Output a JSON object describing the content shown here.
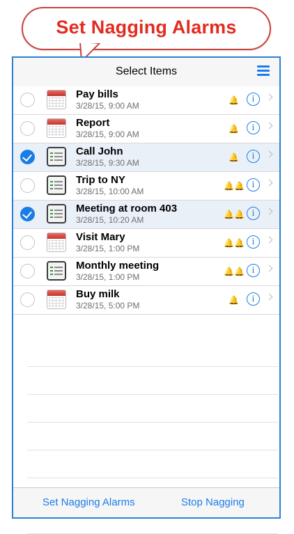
{
  "banner": {
    "title": "Set Nagging Alarms"
  },
  "navbar": {
    "title": "Select Items",
    "menu_icon": "hamburger-menu-icon"
  },
  "items": [
    {
      "title": "Pay bills",
      "time": "3/28/15, 9:00 AM",
      "selected": false,
      "icon": "calendar-icon",
      "bells": "🔔"
    },
    {
      "title": "Report",
      "time": "3/28/15, 9:00 AM",
      "selected": false,
      "icon": "calendar-icon",
      "bells": "🔔"
    },
    {
      "title": "Call John",
      "time": "3/28/15, 9:30 AM",
      "selected": true,
      "icon": "checklist-icon",
      "bells": "🔔"
    },
    {
      "title": "Trip to NY",
      "time": "3/28/15, 10:00 AM",
      "selected": false,
      "icon": "checklist-icon",
      "bells": "🔔🔔"
    },
    {
      "title": "Meeting at room 403",
      "time": "3/28/15, 10:20 AM",
      "selected": true,
      "icon": "checklist-icon",
      "bells": "🔔🔔"
    },
    {
      "title": "Visit Mary",
      "time": "3/28/15, 1:00 PM",
      "selected": false,
      "icon": "calendar-icon",
      "bells": "🔔🔔"
    },
    {
      "title": "Monthly meeting",
      "time": "3/28/15, 1:00 PM",
      "selected": false,
      "icon": "checklist-icon",
      "bells": "🔔🔔"
    },
    {
      "title": "Buy milk",
      "time": "3/28/15, 5:00 PM",
      "selected": false,
      "icon": "calendar-icon",
      "bells": "🔔"
    }
  ],
  "toolbar": {
    "left_label": "Set Nagging Alarms",
    "right_label": "Stop Nagging"
  },
  "colors": {
    "accent": "#1a7ce6",
    "banner_text": "#e32b22",
    "frame": "#2c7fd6",
    "selected_row": "#eaf0f8"
  }
}
